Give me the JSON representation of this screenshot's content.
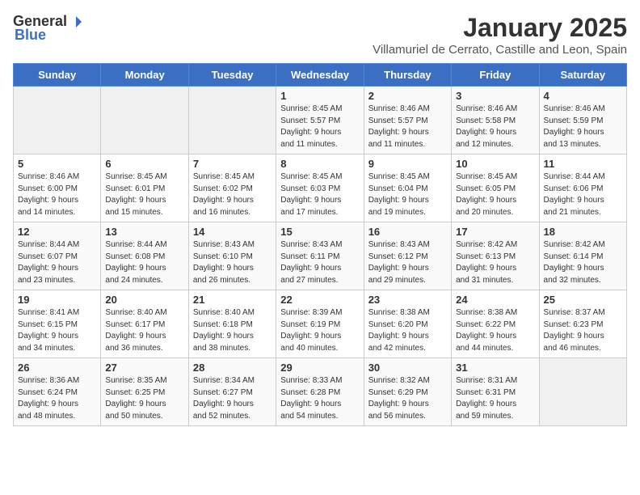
{
  "header": {
    "logo_general": "General",
    "logo_blue": "Blue",
    "month_title": "January 2025",
    "location": "Villamuriel de Cerrato, Castille and Leon, Spain"
  },
  "weekdays": [
    "Sunday",
    "Monday",
    "Tuesday",
    "Wednesday",
    "Thursday",
    "Friday",
    "Saturday"
  ],
  "weeks": [
    [
      {
        "day": "",
        "info": ""
      },
      {
        "day": "",
        "info": ""
      },
      {
        "day": "",
        "info": ""
      },
      {
        "day": "1",
        "info": "Sunrise: 8:45 AM\nSunset: 5:57 PM\nDaylight: 9 hours\nand 11 minutes."
      },
      {
        "day": "2",
        "info": "Sunrise: 8:46 AM\nSunset: 5:57 PM\nDaylight: 9 hours\nand 11 minutes."
      },
      {
        "day": "3",
        "info": "Sunrise: 8:46 AM\nSunset: 5:58 PM\nDaylight: 9 hours\nand 12 minutes."
      },
      {
        "day": "4",
        "info": "Sunrise: 8:46 AM\nSunset: 5:59 PM\nDaylight: 9 hours\nand 13 minutes."
      }
    ],
    [
      {
        "day": "5",
        "info": "Sunrise: 8:46 AM\nSunset: 6:00 PM\nDaylight: 9 hours\nand 14 minutes."
      },
      {
        "day": "6",
        "info": "Sunrise: 8:45 AM\nSunset: 6:01 PM\nDaylight: 9 hours\nand 15 minutes."
      },
      {
        "day": "7",
        "info": "Sunrise: 8:45 AM\nSunset: 6:02 PM\nDaylight: 9 hours\nand 16 minutes."
      },
      {
        "day": "8",
        "info": "Sunrise: 8:45 AM\nSunset: 6:03 PM\nDaylight: 9 hours\nand 17 minutes."
      },
      {
        "day": "9",
        "info": "Sunrise: 8:45 AM\nSunset: 6:04 PM\nDaylight: 9 hours\nand 19 minutes."
      },
      {
        "day": "10",
        "info": "Sunrise: 8:45 AM\nSunset: 6:05 PM\nDaylight: 9 hours\nand 20 minutes."
      },
      {
        "day": "11",
        "info": "Sunrise: 8:44 AM\nSunset: 6:06 PM\nDaylight: 9 hours\nand 21 minutes."
      }
    ],
    [
      {
        "day": "12",
        "info": "Sunrise: 8:44 AM\nSunset: 6:07 PM\nDaylight: 9 hours\nand 23 minutes."
      },
      {
        "day": "13",
        "info": "Sunrise: 8:44 AM\nSunset: 6:08 PM\nDaylight: 9 hours\nand 24 minutes."
      },
      {
        "day": "14",
        "info": "Sunrise: 8:43 AM\nSunset: 6:10 PM\nDaylight: 9 hours\nand 26 minutes."
      },
      {
        "day": "15",
        "info": "Sunrise: 8:43 AM\nSunset: 6:11 PM\nDaylight: 9 hours\nand 27 minutes."
      },
      {
        "day": "16",
        "info": "Sunrise: 8:43 AM\nSunset: 6:12 PM\nDaylight: 9 hours\nand 29 minutes."
      },
      {
        "day": "17",
        "info": "Sunrise: 8:42 AM\nSunset: 6:13 PM\nDaylight: 9 hours\nand 31 minutes."
      },
      {
        "day": "18",
        "info": "Sunrise: 8:42 AM\nSunset: 6:14 PM\nDaylight: 9 hours\nand 32 minutes."
      }
    ],
    [
      {
        "day": "19",
        "info": "Sunrise: 8:41 AM\nSunset: 6:15 PM\nDaylight: 9 hours\nand 34 minutes."
      },
      {
        "day": "20",
        "info": "Sunrise: 8:40 AM\nSunset: 6:17 PM\nDaylight: 9 hours\nand 36 minutes."
      },
      {
        "day": "21",
        "info": "Sunrise: 8:40 AM\nSunset: 6:18 PM\nDaylight: 9 hours\nand 38 minutes."
      },
      {
        "day": "22",
        "info": "Sunrise: 8:39 AM\nSunset: 6:19 PM\nDaylight: 9 hours\nand 40 minutes."
      },
      {
        "day": "23",
        "info": "Sunrise: 8:38 AM\nSunset: 6:20 PM\nDaylight: 9 hours\nand 42 minutes."
      },
      {
        "day": "24",
        "info": "Sunrise: 8:38 AM\nSunset: 6:22 PM\nDaylight: 9 hours\nand 44 minutes."
      },
      {
        "day": "25",
        "info": "Sunrise: 8:37 AM\nSunset: 6:23 PM\nDaylight: 9 hours\nand 46 minutes."
      }
    ],
    [
      {
        "day": "26",
        "info": "Sunrise: 8:36 AM\nSunset: 6:24 PM\nDaylight: 9 hours\nand 48 minutes."
      },
      {
        "day": "27",
        "info": "Sunrise: 8:35 AM\nSunset: 6:25 PM\nDaylight: 9 hours\nand 50 minutes."
      },
      {
        "day": "28",
        "info": "Sunrise: 8:34 AM\nSunset: 6:27 PM\nDaylight: 9 hours\nand 52 minutes."
      },
      {
        "day": "29",
        "info": "Sunrise: 8:33 AM\nSunset: 6:28 PM\nDaylight: 9 hours\nand 54 minutes."
      },
      {
        "day": "30",
        "info": "Sunrise: 8:32 AM\nSunset: 6:29 PM\nDaylight: 9 hours\nand 56 minutes."
      },
      {
        "day": "31",
        "info": "Sunrise: 8:31 AM\nSunset: 6:31 PM\nDaylight: 9 hours\nand 59 minutes."
      },
      {
        "day": "",
        "info": ""
      }
    ]
  ]
}
